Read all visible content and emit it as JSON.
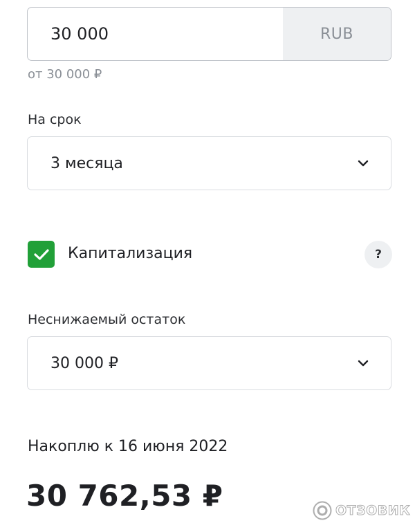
{
  "amount": {
    "value": "30 000",
    "currency": "RUB",
    "hint": "от 30 000 ₽"
  },
  "term": {
    "label": "На срок",
    "selected": "3 месяца"
  },
  "capitalization": {
    "label": "Капитализация",
    "checked": true,
    "help": "?"
  },
  "min_balance": {
    "label": "Неснижаемый остаток",
    "selected": "30 000 ₽"
  },
  "result": {
    "label": "Накоплю к 16 июня 2022",
    "total": "30 762,53 ₽"
  },
  "watermark": {
    "text": "ОТЗОВИК"
  },
  "colors": {
    "accent_green": "#21a038",
    "text": "#1f2024",
    "muted": "#8a8f96",
    "currency_bg": "#eef0f2"
  }
}
